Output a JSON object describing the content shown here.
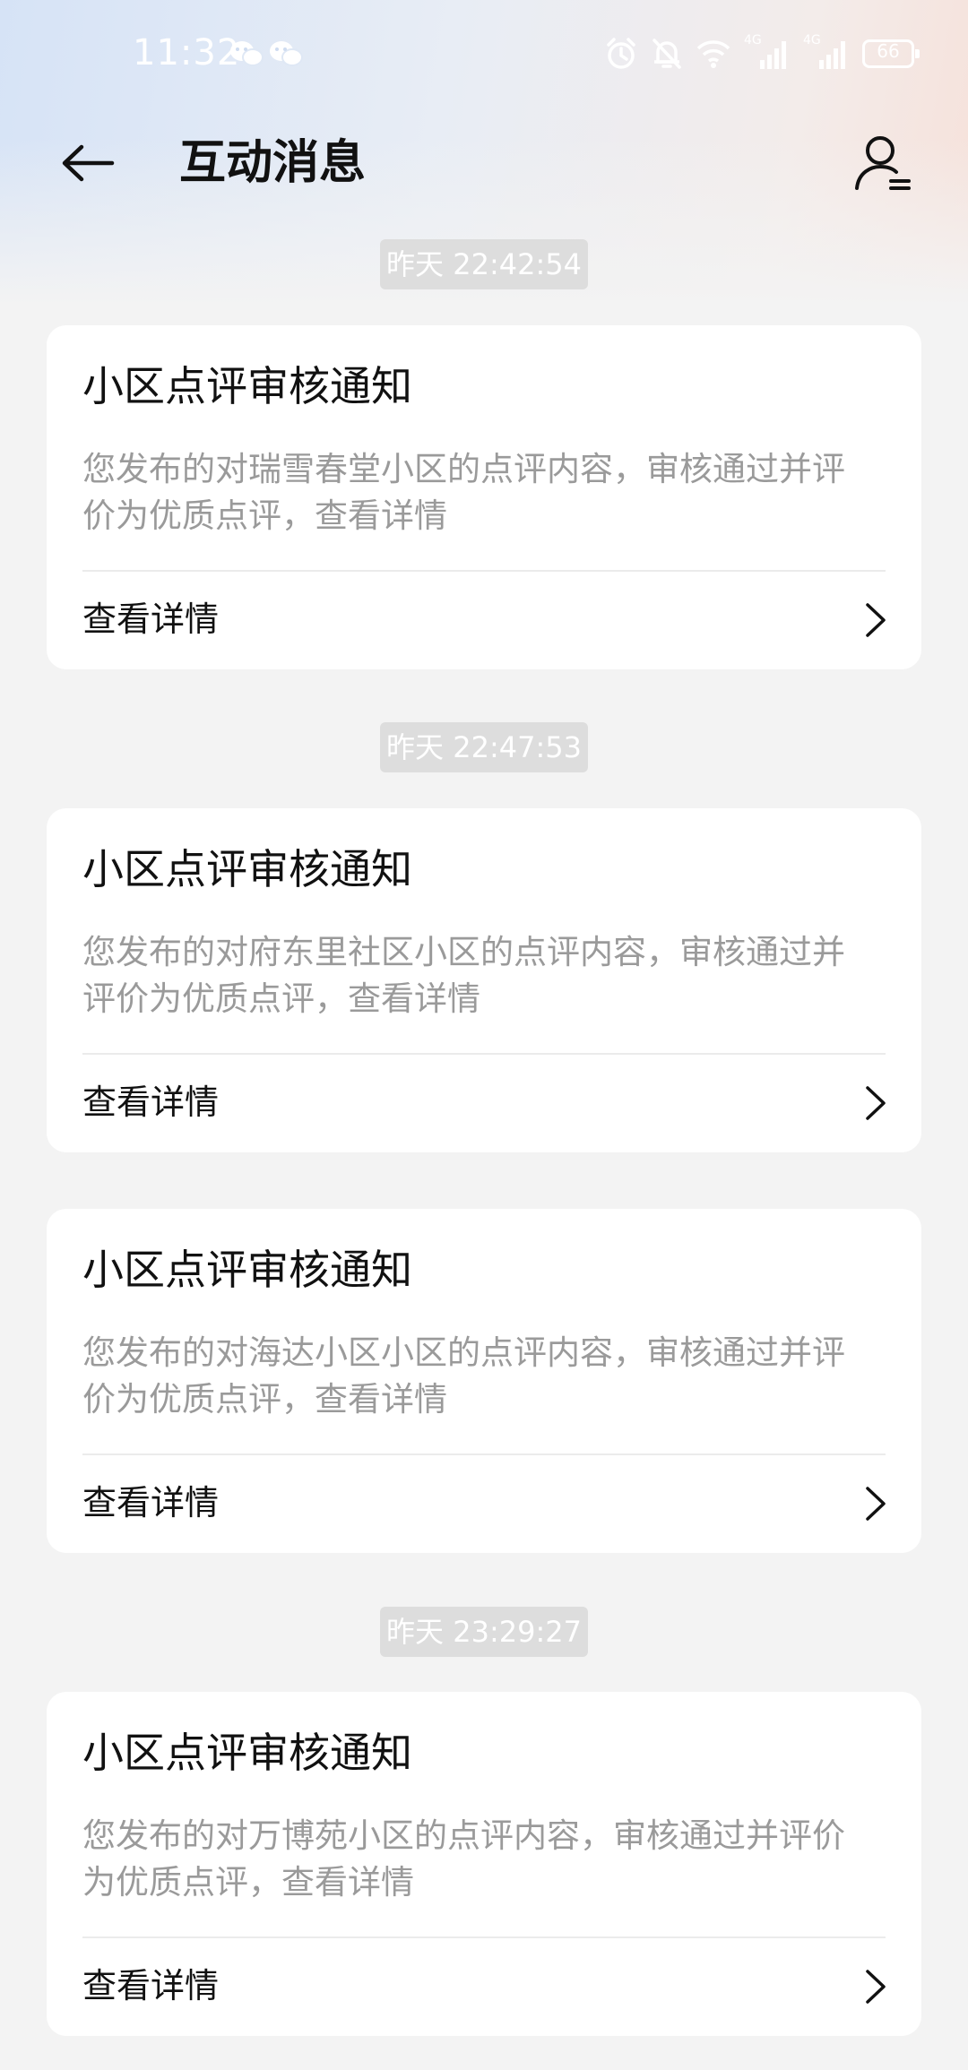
{
  "status_bar": {
    "time": "11:32",
    "battery": "66",
    "network_labels": [
      "4G",
      "4G"
    ]
  },
  "header": {
    "title": "互动消息"
  },
  "messages": [
    {
      "timestamp": "昨天 22:42:54",
      "title": "小区点评审核通知",
      "desc_line1": "您发布的对瑞雪春堂小区的点评内容，审核通过并评",
      "desc_line2": "价为优质点评，查看详情",
      "link": "查看详情"
    },
    {
      "timestamp": "昨天 22:47:53",
      "title": "小区点评审核通知",
      "desc_line1": "您发布的对府东里社区小区的点评内容，审核通过并",
      "desc_line2": "评价为优质点评，查看详情",
      "link": "查看详情"
    },
    {
      "timestamp": "",
      "title": "小区点评审核通知",
      "desc_line1": "您发布的对海达小区小区的点评内容，审核通过并评",
      "desc_line2": "价为优质点评，查看详情",
      "link": "查看详情"
    },
    {
      "timestamp": "昨天 23:29:27",
      "title": "小区点评审核通知",
      "desc_line1": "您发布的对万博苑小区的点评内容，审核通过并评价",
      "desc_line2": "为优质点评，查看详情",
      "link": "查看详情"
    }
  ],
  "icons": {
    "back": "arrow-left-icon",
    "profile": "user-list-icon",
    "chevron": "chevron-right-icon"
  },
  "colors": {
    "background": "#f3f3f3",
    "card": "#ffffff",
    "timestamp_bg": "#dddddd",
    "secondary_text": "#9a9a9a"
  }
}
